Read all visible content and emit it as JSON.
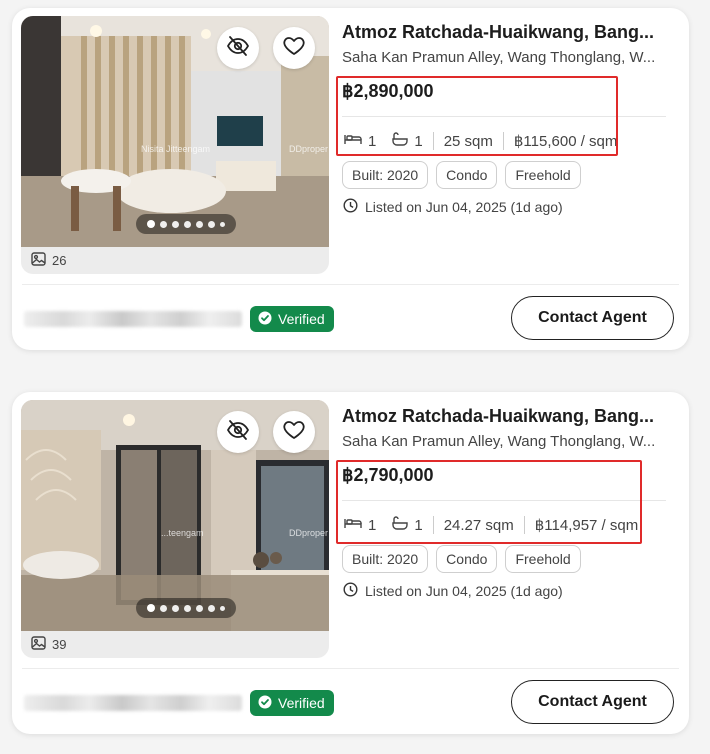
{
  "listings": [
    {
      "title": "Atmoz Ratchada-Huaikwang, Bang...",
      "address": "Saha Kan Pramun Alley, Wang Thonglang, W...",
      "price": "฿2,890,000",
      "beds": "1",
      "baths": "1",
      "area": "25 sqm",
      "price_per_sqm": "฿115,600 / sqm",
      "tags": [
        "Built: 2020",
        "Condo",
        "Freehold"
      ],
      "listed": "Listed on Jun 04, 2025 (1d ago)",
      "photo_count": "26",
      "photo_watermark": "Nisita Jitteengam",
      "photo_brand": "DDproper",
      "verified_label": "Verified",
      "contact_label": "Contact Agent"
    },
    {
      "title": "Atmoz Ratchada-Huaikwang, Bang...",
      "address": "Saha Kan Pramun Alley, Wang Thonglang, W...",
      "price": "฿2,790,000",
      "beds": "1",
      "baths": "1",
      "area": "24.27 sqm",
      "price_per_sqm": "฿114,957 / sqm",
      "tags": [
        "Built: 2020",
        "Condo",
        "Freehold"
      ],
      "listed": "Listed on Jun 04, 2025 (1d ago)",
      "photo_count": "39",
      "photo_watermark": "...teengam",
      "photo_brand": "DDproper",
      "verified_label": "Verified",
      "contact_label": "Contact Agent"
    }
  ],
  "icons": {
    "hide": "eye-slash-icon",
    "favorite": "heart-icon",
    "bed": "bed-icon",
    "bath": "bathtub-icon",
    "clock": "clock-icon",
    "gallery": "image-icon",
    "verified": "badge-check-icon"
  },
  "colors": {
    "verified_bg": "#138a4b",
    "highlight_border": "#e02a2a"
  }
}
